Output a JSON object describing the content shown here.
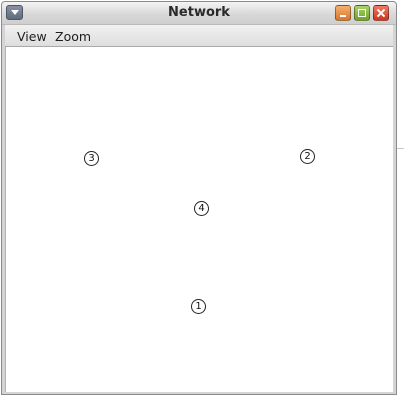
{
  "window": {
    "title": "Network"
  },
  "menubar": {
    "items": [
      "View",
      "Zoom"
    ]
  },
  "nodes": [
    {
      "id": "1",
      "label": "1"
    },
    {
      "id": "2",
      "label": "2"
    },
    {
      "id": "3",
      "label": "3"
    },
    {
      "id": "4",
      "label": "4"
    }
  ]
}
